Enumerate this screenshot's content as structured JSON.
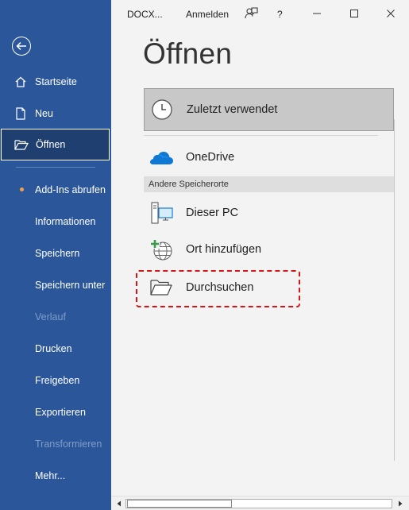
{
  "titlebar": {
    "doc_name": "DOCX...",
    "signin_label": "Anmelden",
    "help_label": "?"
  },
  "sidebar": {
    "items": [
      {
        "label": "Startseite"
      },
      {
        "label": "Neu"
      },
      {
        "label": "Öffnen"
      },
      {
        "label": "Add-Ins abrufen"
      },
      {
        "label": "Informationen"
      },
      {
        "label": "Speichern"
      },
      {
        "label": "Speichern unter"
      },
      {
        "label": "Verlauf"
      },
      {
        "label": "Drucken"
      },
      {
        "label": "Freigeben"
      },
      {
        "label": "Exportieren"
      },
      {
        "label": "Transformieren"
      },
      {
        "label": "Mehr..."
      }
    ],
    "active": "Öffnen",
    "disabled": [
      "Verlauf",
      "Transformieren"
    ]
  },
  "main": {
    "title": "Öffnen",
    "recent_label": "Zuletzt verwendet",
    "onedrive_label": "OneDrive",
    "other_locations_header": "Andere Speicherorte",
    "this_pc_label": "Dieser PC",
    "add_place_label": "Ort hinzufügen",
    "browse_label": "Durchsuchen"
  },
  "colors": {
    "sidebar_bg": "#2b579a",
    "sidebar_active_bg": "#1e3f70",
    "highlight_dash": "#d41515",
    "onedrive_blue": "#0f78d4",
    "addin_dot": "#f0a04a"
  }
}
